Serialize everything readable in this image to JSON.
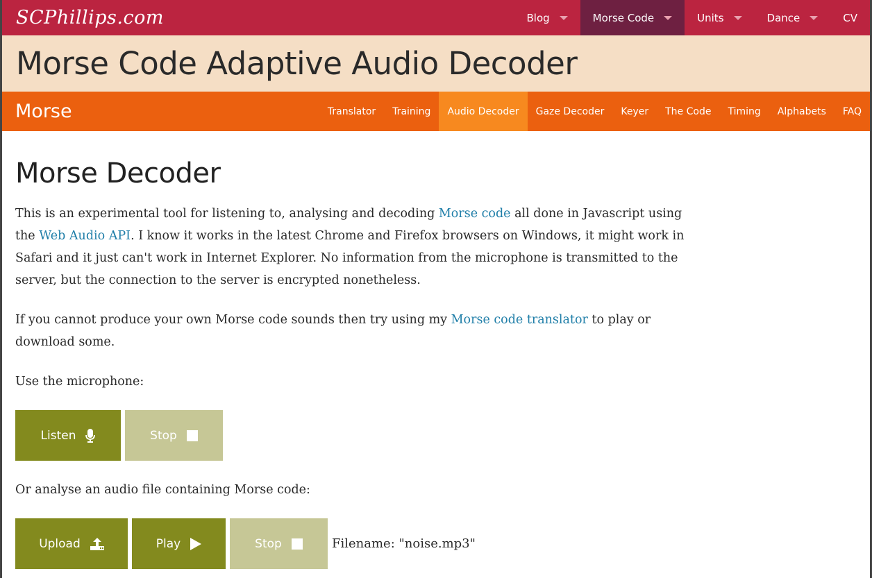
{
  "topbar": {
    "logo": "SCPhillips.com",
    "nav": [
      {
        "label": "Blog",
        "dropdown": true
      },
      {
        "label": "Morse Code",
        "dropdown": true,
        "active": true
      },
      {
        "label": "Units",
        "dropdown": true
      },
      {
        "label": "Dance",
        "dropdown": true
      },
      {
        "label": "CV",
        "dropdown": false
      }
    ]
  },
  "page_title": "Morse Code Adaptive Audio Decoder",
  "section_nav": {
    "brand": "Morse",
    "links": [
      "Translator",
      "Training",
      "Audio Decoder",
      "Gaze Decoder",
      "Keyer",
      "The Code",
      "Timing",
      "Alphabets",
      "FAQ"
    ],
    "active": "Audio Decoder"
  },
  "main": {
    "heading": "Morse Decoder",
    "para1": {
      "t1": "This is an experimental tool for listening to, analysing and decoding ",
      "link1": "Morse code",
      "t2": " all done in Javascript using the ",
      "link2": "Web Audio API",
      "t3": ". I know it works in the latest Chrome and Firefox browsers on Windows, it might work in Safari and it just can't work in Internet Explorer. No information from the microphone is transmitted to the server, but the connection to the server is encrypted nonetheless."
    },
    "para2": {
      "t1": "If you cannot produce your own Morse code sounds then try using my ",
      "link": "Morse code translator",
      "t2": " to play or download some."
    },
    "mic_label": "Use the microphone:",
    "listen_label": "Listen",
    "stop_label": "Stop",
    "file_label": "Or analyse an audio file containing Morse code:",
    "upload_label": "Upload",
    "play_label": "Play",
    "stop2_label": "Stop",
    "filename": "Filename: \"noise.mp3\""
  },
  "colors": {
    "topbar": "#bb2440",
    "topbar_active": "#6e2041",
    "title_band": "#f5dec5",
    "section_nav": "#eb600f",
    "section_active": "#f7891f",
    "button": "#838a1e",
    "button_disabled": "#c6c796",
    "link": "#1f7ea8"
  },
  "icons": {
    "listen": "microphone-icon",
    "stop": "stop-square-icon",
    "upload": "upload-icon",
    "play": "play-triangle-icon",
    "dropdown": "caret-down-icon"
  }
}
